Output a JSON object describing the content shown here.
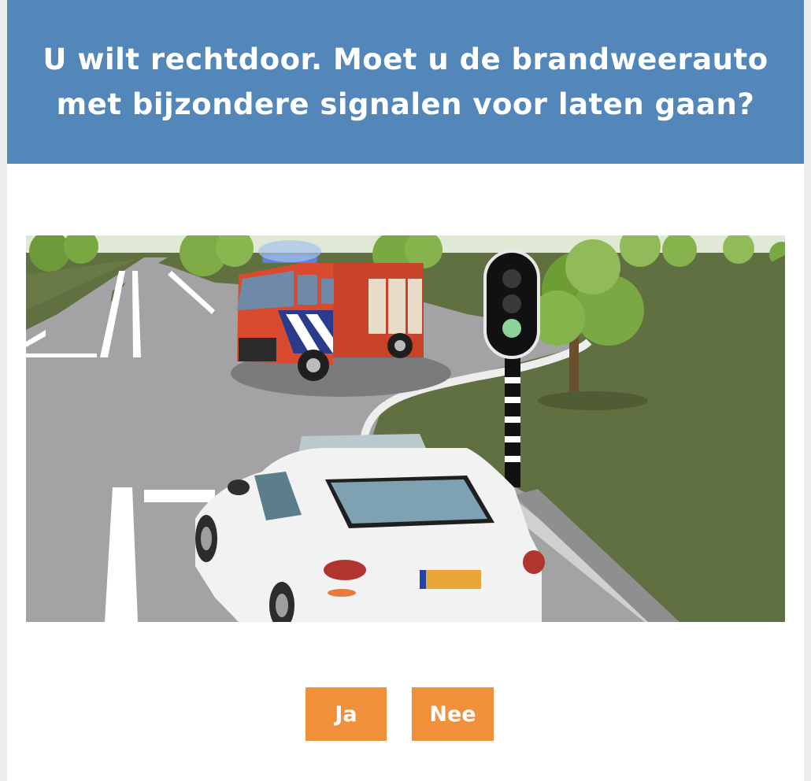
{
  "question": {
    "title": "U wilt rechtdoor. Moet u de brandweerauto met bijzondere signalen voor laten gaan?"
  },
  "illustration": {
    "subject": "intersection-fire-truck-traffic-light",
    "traffic_light_state": "green"
  },
  "answers": {
    "yes_label": "Ja",
    "no_label": "Nee"
  },
  "colors": {
    "header": "#5387b9",
    "button": "#f0903a",
    "button_text": "#ffffff",
    "grass": "#617040",
    "road": "#a3a3a6"
  }
}
